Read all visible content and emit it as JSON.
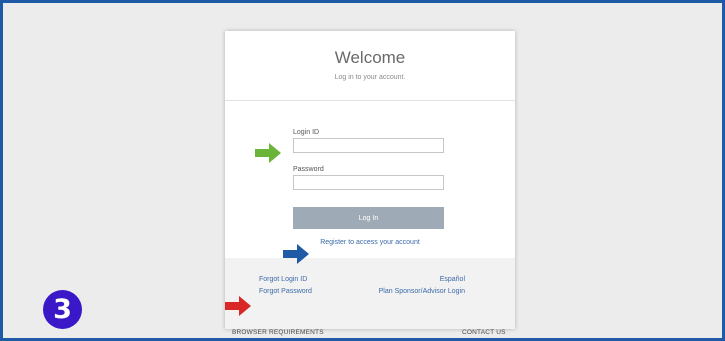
{
  "card": {
    "title": "Welcome",
    "subtitle": "Log in to your account.",
    "login_id_label": "Login ID",
    "login_id_value": "",
    "password_label": "Password",
    "password_value": "",
    "login_button": "Log In",
    "register_link": "Register to access your account"
  },
  "footer": {
    "forgot_login_id": "Forgot Login ID",
    "forgot_password": "Forgot Password",
    "espanol": "Español",
    "plan_sponsor": "Plan Sponsor/Advisor Login"
  },
  "below_card": {
    "browser_requirements": "BROWSER REQUIREMENTS",
    "contact_us": "CONTACT US"
  },
  "step_badge": "3",
  "colors": {
    "frame_border": "#1f5aa6",
    "green_arrow": "#6ab43a",
    "blue_arrow": "#1f5aa6",
    "red_arrow": "#d92626",
    "badge": "#3a18c8"
  },
  "icons": [
    "green-arrow-icon",
    "blue-arrow-icon",
    "red-arrow-icon"
  ]
}
